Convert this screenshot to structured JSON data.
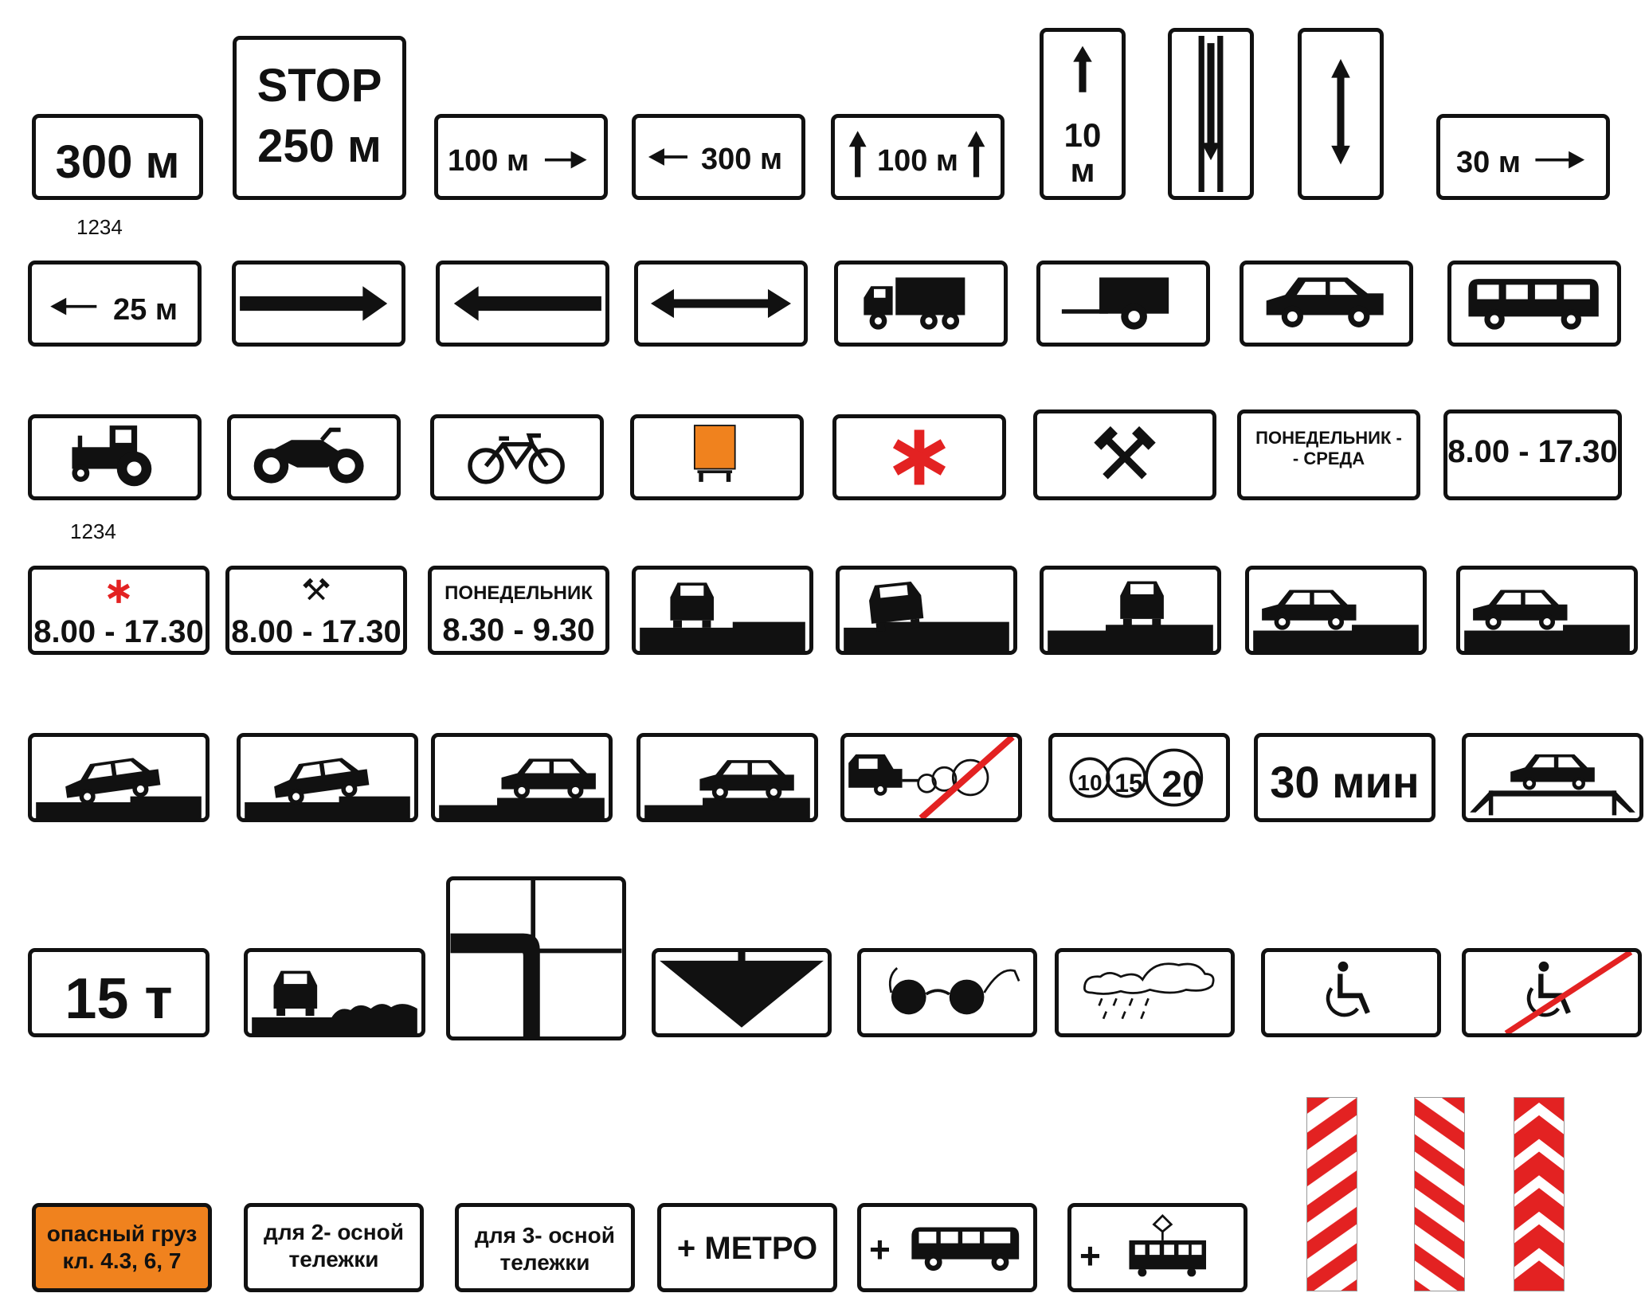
{
  "labels": [
    "1234",
    "1234"
  ],
  "row1": {
    "dist_300": "300 м",
    "stop_line1": "STOP",
    "stop_line2": "250 м",
    "dist_100_right": "100 м",
    "dist_300_left": "300 м",
    "dist_100_up": "100 м",
    "vertical_10": "10",
    "vertical_m": "м",
    "dist_30_right": "30 м"
  },
  "row2": {
    "dist_25_left": "25 м"
  },
  "row3": {
    "days_line1": "ПОНЕДЕЛЬНИК -",
    "days_line2": "- СРЕДА",
    "time_range": "8.00 - 17.30"
  },
  "row4": {
    "time_red_star": "8.00 - 17.30",
    "time_hammers": "8.00 - 17.30",
    "monday_label": "ПОНЕДЕЛЬНИК",
    "monday_time": "8.30 - 9.30"
  },
  "row5": {
    "speed_a": "10",
    "speed_b": "15",
    "speed_c": "20",
    "duration": "30 мин"
  },
  "row6": {
    "weight": "15 т"
  },
  "row7": {
    "hazard_line1": "опасный груз",
    "hazard_line2": "кл. 4.3, 6, 7",
    "axle2_line1": "для 2- осной",
    "axle2_line2": "тележки",
    "axle3_line1": "для 3- осной",
    "axle3_line2": "тележки",
    "metro": "+ МЕТРО",
    "plus_bus": "+",
    "plus_tram": "+"
  },
  "colors": {
    "red": "#e32222",
    "orange": "#f0821e",
    "black": "#111111"
  }
}
